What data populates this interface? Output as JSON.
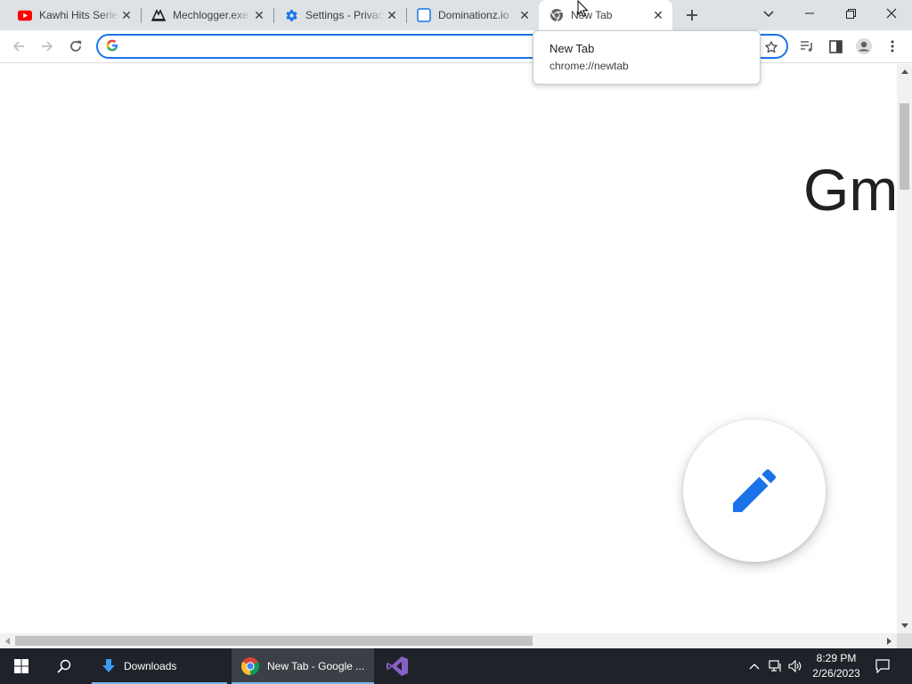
{
  "tabs": [
    {
      "title": "Kawhi Hits Series",
      "favicon": "youtube-icon"
    },
    {
      "title": "Mechlogger.exe",
      "favicon": "mechlogger-icon"
    },
    {
      "title": "Settings - Privacy",
      "favicon": "gear-icon"
    },
    {
      "title": "Dominationz.io",
      "favicon": "blank-page-icon"
    },
    {
      "title": "New Tab",
      "favicon": "chrome-icon",
      "active": true
    }
  ],
  "omnibox": {
    "value": "",
    "placeholder": ""
  },
  "hovercard": {
    "title": "New Tab",
    "url": "chrome://newtab"
  },
  "content": {
    "partial_text": "Gm"
  },
  "taskbar": {
    "apps": [
      {
        "label": "Downloads",
        "icon": "download-arrow-icon"
      },
      {
        "label": "New Tab - Google ...",
        "icon": "chrome-icon"
      },
      {
        "label": "",
        "icon": "visual-studio-icon"
      }
    ],
    "time": "8:29 PM",
    "date": "2/26/2023"
  },
  "colors": {
    "accent": "#1a73e8",
    "tabstrip": "#dee1e6",
    "taskbar": "#1f2228",
    "youtube_red": "#ff0000"
  }
}
